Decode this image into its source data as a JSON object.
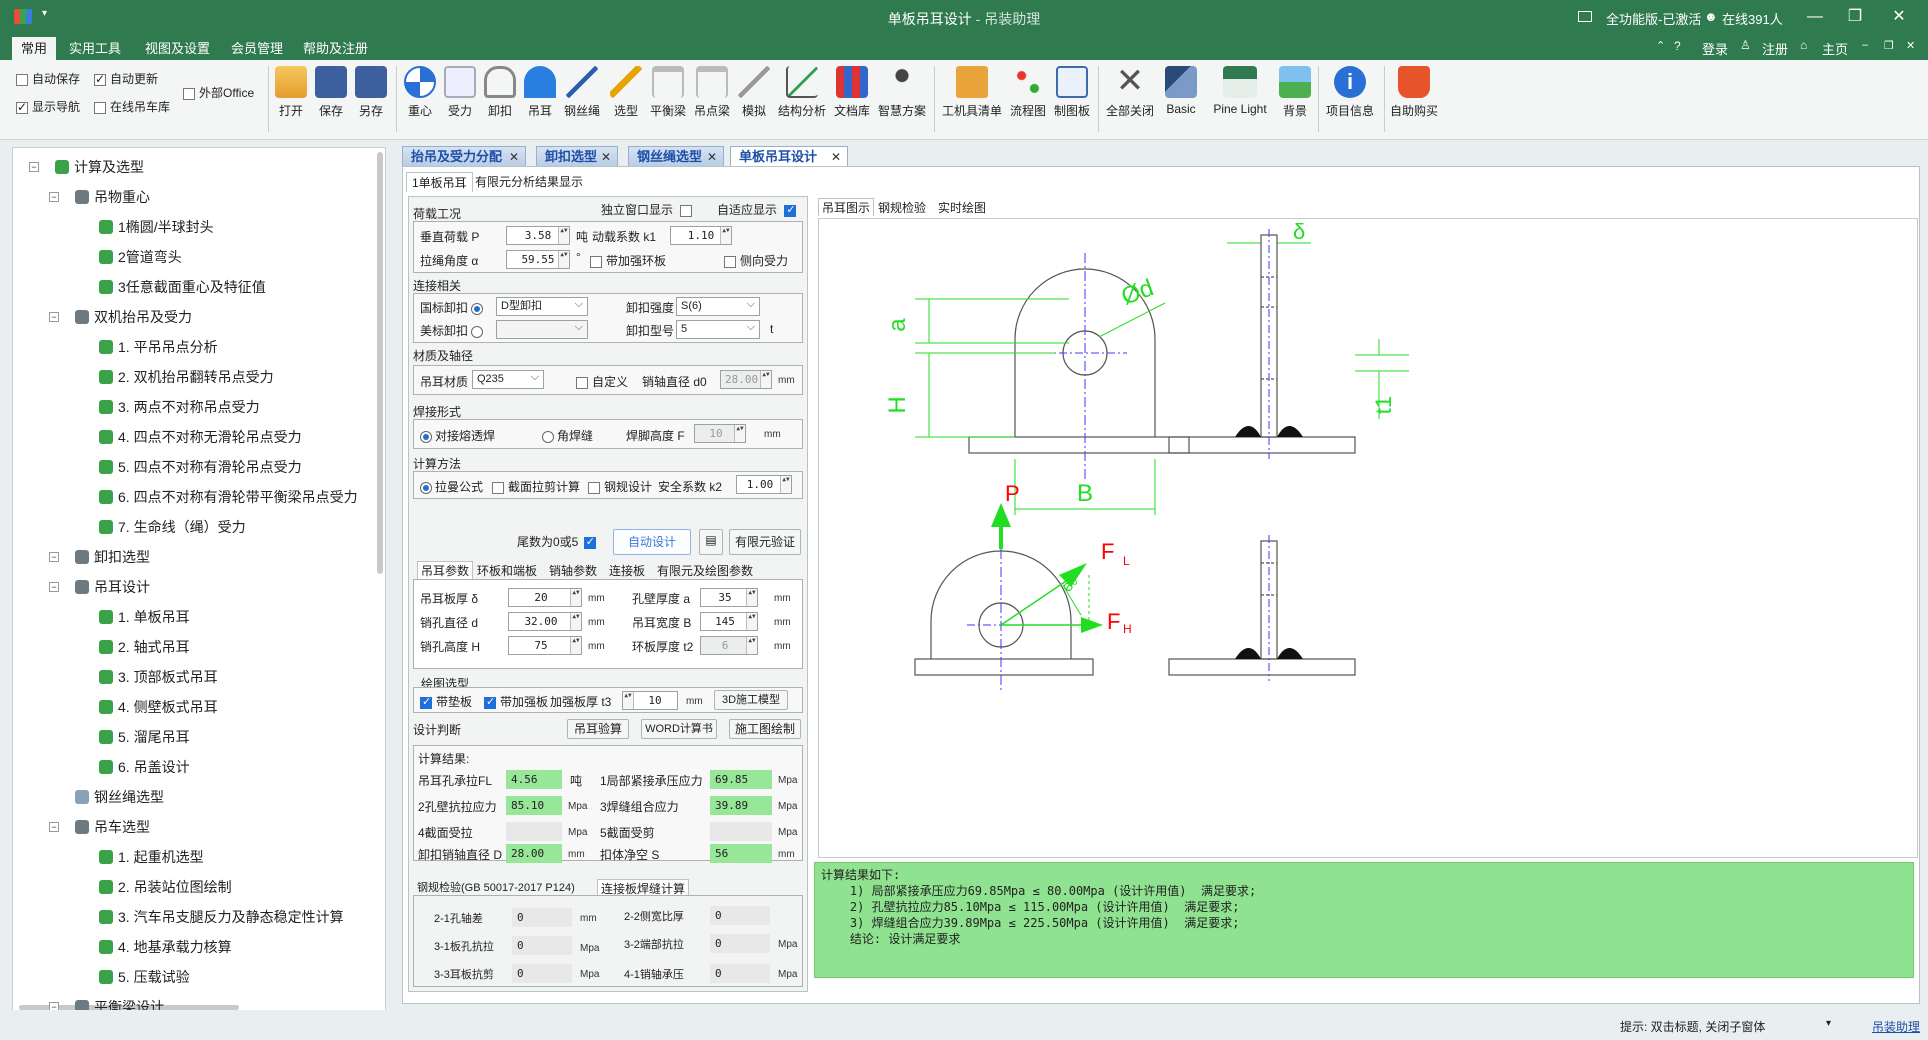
{
  "window": {
    "title": "单板吊耳设计",
    "subtitle": " - 吊装助理",
    "license": "全功能版-已激活",
    "online": "在线391人",
    "min": "—",
    "max": "❐",
    "close": "✕"
  },
  "menu": {
    "items": [
      "常用",
      "实用工具",
      "视图及设置",
      "会员管理",
      "帮助及注册"
    ],
    "right": [
      "登录",
      "注册",
      "主页"
    ]
  },
  "ribbon": {
    "checks": [
      {
        "label": "自动保存",
        "on": false
      },
      {
        "label": "自动更新",
        "on": true
      },
      {
        "label": "外部Office",
        "on": false
      },
      {
        "label": "显示导航",
        "on": true
      },
      {
        "label": "在线吊车库",
        "on": false
      }
    ],
    "tools": [
      "打开",
      "保存",
      "另存",
      "重心",
      "受力",
      "卸扣",
      "吊耳",
      "钢丝绳",
      "选型",
      "平衡梁",
      "吊点梁",
      "模拟",
      "结构分析",
      "文档库",
      "智慧方案",
      "工机具清单",
      "流程图",
      "制图板",
      "全部关闭",
      "Basic",
      "Pine Light",
      "背景",
      "项目信息",
      "自助购买"
    ]
  },
  "tree": [
    {
      "label": "计算及选型",
      "level": 0,
      "icon": "leaf"
    },
    {
      "label": "吊物重心",
      "level": 1,
      "icon": "grp"
    },
    {
      "label": "1椭圆/半球封头",
      "level": 2,
      "icon": "leaf"
    },
    {
      "label": "2管道弯头",
      "level": 2,
      "icon": "leaf"
    },
    {
      "label": "3任意截面重心及特征值",
      "level": 2,
      "icon": "leaf"
    },
    {
      "label": "双机抬吊及受力",
      "level": 1,
      "icon": "grp"
    },
    {
      "label": "1. 平吊吊点分析",
      "level": 2,
      "icon": "leaf"
    },
    {
      "label": "2. 双机抬吊翻转吊点受力",
      "level": 2,
      "icon": "leaf"
    },
    {
      "label": "3. 两点不对称吊点受力",
      "level": 2,
      "icon": "leaf"
    },
    {
      "label": "4. 四点不对称无滑轮吊点受力",
      "level": 2,
      "icon": "leaf"
    },
    {
      "label": "5. 四点不对称有滑轮吊点受力",
      "level": 2,
      "icon": "leaf"
    },
    {
      "label": "6. 四点不对称有滑轮带平衡梁吊点受力",
      "level": 2,
      "icon": "leaf"
    },
    {
      "label": "7. 生命线（绳）受力",
      "level": 2,
      "icon": "leaf"
    },
    {
      "label": "卸扣选型",
      "level": 1,
      "icon": "grp"
    },
    {
      "label": "吊耳设计",
      "level": 1,
      "icon": "grp"
    },
    {
      "label": "1. 单板吊耳",
      "level": 2,
      "icon": "leaf"
    },
    {
      "label": "2. 轴式吊耳",
      "level": 2,
      "icon": "leaf"
    },
    {
      "label": "3. 顶部板式吊耳",
      "level": 2,
      "icon": "leaf"
    },
    {
      "label": "4. 侧壁板式吊耳",
      "level": 2,
      "icon": "leaf"
    },
    {
      "label": "5. 溜尾吊耳",
      "level": 2,
      "icon": "leaf"
    },
    {
      "label": "6. 吊盖设计",
      "level": 2,
      "icon": "leaf"
    },
    {
      "label": "钢丝绳选型",
      "level": 1,
      "icon": "pen"
    },
    {
      "label": "吊车选型",
      "level": 1,
      "icon": "grp"
    },
    {
      "label": "1. 起重机选型",
      "level": 2,
      "icon": "leaf"
    },
    {
      "label": "2. 吊装站位图绘制",
      "level": 2,
      "icon": "leaf"
    },
    {
      "label": "3. 汽车吊支腿反力及静态稳定性计算",
      "level": 2,
      "icon": "leaf"
    },
    {
      "label": "4. 地基承载力核算",
      "level": 2,
      "icon": "leaf"
    },
    {
      "label": "5. 压载试验",
      "level": 2,
      "icon": "leaf"
    },
    {
      "label": "平衡梁设计",
      "level": 1,
      "icon": "grp"
    }
  ],
  "docTabs": [
    {
      "label": "抬吊及受力分配",
      "active": false
    },
    {
      "label": "卸扣选型",
      "active": false
    },
    {
      "label": "钢丝绳选型",
      "active": false
    },
    {
      "label": "单板吊耳设计",
      "active": true
    }
  ],
  "subTabs": [
    "1单板吊耳",
    "有限元分析结果显示"
  ],
  "form": {
    "load": {
      "title": "荷载工况",
      "indep": "独立窗口显示",
      "adapt": "自适应显示",
      "vload": "垂直荷载 P",
      "vload_val": "3.58",
      "ton": "吨",
      "dyn": "动载系数 k1",
      "dyn_val": "1.10",
      "angle": "拉绳角度 α",
      "angle_val": "59.55",
      "deg": "°",
      "ring": "带加强环板",
      "side": "侧向受力"
    },
    "conn": {
      "title": "连接相关",
      "gb": "国标卸扣",
      "gb_type": "D型卸扣",
      "grade_lbl": "卸扣强度",
      "grade": "S(6)",
      "us": "美标卸扣",
      "model_lbl": "卸扣型号",
      "model": "5",
      "t": "t"
    },
    "mat": {
      "title": "材质及轴径",
      "lbl": "吊耳材质",
      "val": "Q235",
      "custom": "自定义",
      "pin": "销轴直径 d0",
      "pin_val": "28.00",
      "mm": "mm"
    },
    "weld": {
      "title": "焊接形式",
      "butt": "对接熔透焊",
      "fillet": "角焊缝",
      "foot": "焊脚高度 F",
      "foot_val": "10",
      "mm": "mm"
    },
    "calc": {
      "title": "计算方法",
      "lame": "拉曼公式",
      "shear": "截面拉剪计算",
      "code": "钢规设计",
      "safety": "安全系数 k2",
      "safety_val": "1.00"
    },
    "round": "尾数为0或5",
    "auto": "自动设计",
    "fea": "有限元验证",
    "paramTabs": [
      "吊耳参数",
      "环板和端板",
      "销轴参数",
      "连接板",
      "有限元及绘图参数"
    ],
    "params": {
      "thk": "吊耳板厚 δ",
      "thk_val": "20",
      "hole": "销孔直径 d",
      "hole_val": "32.00",
      "h": "销孔高度 H",
      "h_val": "75",
      "wall": "孔壁厚度 a",
      "wall_val": "35",
      "width": "吊耳宽度 B",
      "width_val": "145",
      "ring": "环板厚度 t2",
      "ring_val": "6",
      "mm": "mm"
    },
    "draw": {
      "title": "绘图选型",
      "pad": "带垫板",
      "rib": "带加强板",
      "rib_thk": "加强板厚 t3",
      "rib_val": "10",
      "mm": "mm",
      "model3d": "3D施工模型"
    },
    "judge": {
      "title": "设计判断",
      "check": "吊耳验算",
      "word": "WORD计算书",
      "cad": "施工图绘制"
    },
    "results": {
      "title": "计算结果:",
      "r1": "吊耳孔承拉FL",
      "r1v": "4.56",
      "r1u": "吨",
      "r2": "1局部紧接承压应力",
      "r2v": "69.85",
      "r2u": "Mpa",
      "r3": "2孔壁抗拉应力",
      "r3v": "85.10",
      "r3u": "Mpa",
      "r4": "3焊缝组合应力",
      "r4v": "39.89",
      "r4u": "Mpa",
      "r5": "4截面受拉",
      "r5u": "Mpa",
      "r6": "5截面受剪",
      "r6u": "Mpa",
      "r7": "卸扣销轴直径 D",
      "r7v": "28.00",
      "r7u": "mm",
      "r8": "扣体净空 S",
      "r8v": "56",
      "r8u": "mm"
    },
    "code": {
      "tab1": "钢规检验(GB 50017-2017 P124)",
      "tab2": "连接板焊缝计算",
      "c1": "2-1孔轴差",
      "c1v": "0",
      "c1u": "mm",
      "c2": "2-2侧宽比厚",
      "c2v": "0",
      "c3": "3-1板孔抗拉",
      "c3v": "0",
      "c3u": "Mpa",
      "c4": "3-2端部抗拉",
      "c4v": "0",
      "c4u": "Mpa",
      "c5": "3-3耳板抗剪",
      "c5v": "0",
      "c5u": "Mpa",
      "c6": "4-1销轴承压",
      "c6v": "0",
      "c6u": "Mpa"
    }
  },
  "drawTabs": [
    "吊耳图示",
    "钢规检验",
    "实时绘图"
  ],
  "drawing": {
    "a": "a",
    "H": "H",
    "B": "B",
    "d": "Ød",
    "delta": "δ",
    "t1": "t1",
    "P": "P",
    "FL": "F",
    "FLsub": "L",
    "FH": "F",
    "FHsub": "H",
    "eo": "e。"
  },
  "resultText": "计算结果如下:\n    1) 局部紧接承压应力69.85Mpa ≤ 80.00Mpa (设计许用值)  满足要求;\n    2) 孔壁抗拉应力85.10Mpa ≤ 115.00Mpa (设计许用值)  满足要求;\n    3) 焊缝组合应力39.89Mpa ≤ 225.50Mpa (设计许用值)  满足要求;\n    结论: 设计满足要求",
  "status": {
    "hint": "提示: 双击标题, 关闭子窗体",
    "link": "吊装助理"
  },
  "colors": {
    "titlebar": "#2f7a4f",
    "green_field": "#98e698",
    "results_bg": "#8fe28f",
    "drawing_green": "#00e000",
    "drawing_red": "#ff0000"
  }
}
